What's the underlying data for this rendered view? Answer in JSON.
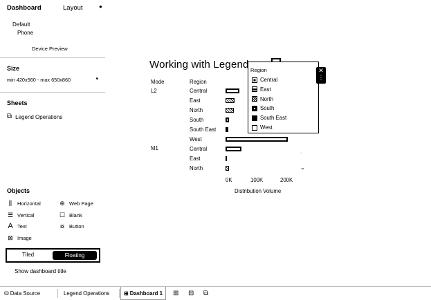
{
  "left_panel": {
    "tabs": [
      "Dashboard",
      "Layout"
    ],
    "device_preview": {
      "label1": "Default",
      "label2": "Phone",
      "button": "Device Preview"
    },
    "size": {
      "title": "Size",
      "value": "min 420x560 - max 650x860"
    },
    "sheets": {
      "title": "Sheets",
      "items": [
        "Legend Operations"
      ]
    },
    "objects": {
      "title": "Objects",
      "items": [
        {
          "label": "Horizontal",
          "icon": "horizontal-icon"
        },
        {
          "label": "Web Page",
          "icon": "globe-icon"
        },
        {
          "label": "Vertical",
          "icon": "vertical-icon"
        },
        {
          "label": "Blank",
          "icon": "blank-icon"
        },
        {
          "label": "Text",
          "icon": "text-icon"
        },
        {
          "label": "Button",
          "icon": "button-icon"
        },
        {
          "label": "Image",
          "icon": "image-icon"
        }
      ]
    },
    "layout_toggle": {
      "options": [
        "Tiled",
        "Floating"
      ],
      "selected": "Floating"
    },
    "show_title": "Show dashboard title"
  },
  "chart": {
    "title": "Working with Legends"
  },
  "chart_data": {
    "type": "bar",
    "orientation": "horizontal",
    "title": "Working with Legends",
    "row_headers": [
      "Mode",
      "Region"
    ],
    "xlabel": "Distribution Volume",
    "x_ticks": [
      "0K",
      "100K",
      "200K"
    ],
    "xlim": [
      0,
      200000
    ],
    "series": [
      {
        "mode": "L2",
        "region": "Central",
        "value": 45000
      },
      {
        "mode": "L2",
        "region": "East",
        "value": 30000
      },
      {
        "mode": "L2",
        "region": "North",
        "value": 28000
      },
      {
        "mode": "L2",
        "region": "South",
        "value": 12000
      },
      {
        "mode": "L2",
        "region": "South East",
        "value": 7000
      },
      {
        "mode": "L2",
        "region": "West",
        "value": 205000
      },
      {
        "mode": "M1",
        "region": "Central",
        "value": 52000
      },
      {
        "mode": "M1",
        "region": "East",
        "value": 2000
      },
      {
        "mode": "M1",
        "region": "North",
        "value": 11000
      }
    ],
    "legend": {
      "title": "Region",
      "items": [
        {
          "label": "Central",
          "pattern": "central"
        },
        {
          "label": "East",
          "pattern": "east"
        },
        {
          "label": "North",
          "pattern": "north"
        },
        {
          "label": "South",
          "pattern": "south"
        },
        {
          "label": "South East",
          "pattern": "southeast"
        },
        {
          "label": "West",
          "pattern": "west"
        }
      ],
      "placement": "top-right"
    }
  },
  "bottom_tabs": {
    "data_source": "Data Source",
    "sheet": "Legend Operations",
    "dashboard": "Dashboard 1"
  }
}
